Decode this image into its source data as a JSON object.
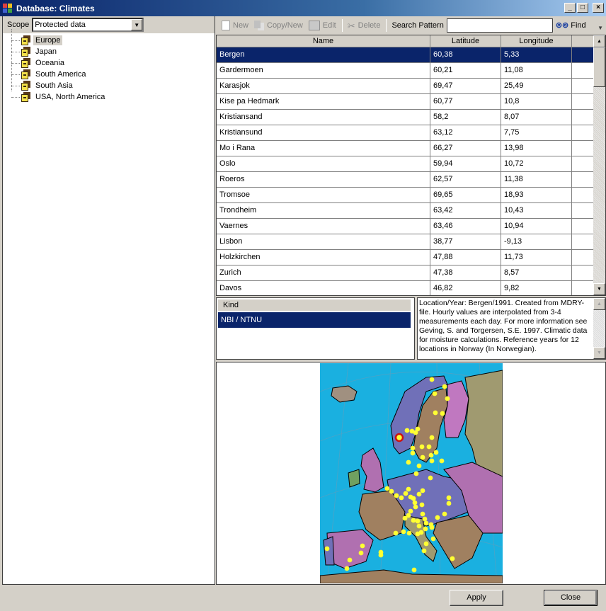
{
  "window": {
    "title": "Database: Climates",
    "controls": {
      "minimize": "_",
      "maximize": "□",
      "close": "×"
    }
  },
  "scope": {
    "label": "Scope",
    "selected": "Protected data"
  },
  "tree": {
    "items": [
      {
        "label": "Europe",
        "icon": "database-icon",
        "selected": true
      },
      {
        "label": "Japan",
        "icon": "database-icon",
        "selected": false
      },
      {
        "label": "Oceania",
        "icon": "database-icon",
        "selected": false
      },
      {
        "label": "South America",
        "icon": "database-icon",
        "selected": false
      },
      {
        "label": "South Asia",
        "icon": "database-icon",
        "selected": false
      },
      {
        "label": "USA, North America",
        "icon": "database-icon",
        "selected": false
      }
    ]
  },
  "toolbar": {
    "new_label": "New",
    "copy_new_label": "Copy/New",
    "edit_label": "Edit",
    "delete_label": "Delete",
    "search_label": "Search Pattern",
    "search_value": "",
    "find_label": "Find"
  },
  "grid": {
    "columns": [
      "Name",
      "Latitude",
      "Longitude"
    ],
    "rows": [
      {
        "name": "Bergen",
        "lat": "60,38",
        "lon": "5,33",
        "selected": true
      },
      {
        "name": "Gardermoen",
        "lat": "60,21",
        "lon": "11,08"
      },
      {
        "name": "Karasjok",
        "lat": "69,47",
        "lon": "25,49"
      },
      {
        "name": "Kise pa Hedmark",
        "lat": "60,77",
        "lon": "10,8"
      },
      {
        "name": "Kristiansand",
        "lat": "58,2",
        "lon": "8,07"
      },
      {
        "name": "Kristiansund",
        "lat": "63,12",
        "lon": "7,75"
      },
      {
        "name": "Mo i Rana",
        "lat": "66,27",
        "lon": "13,98"
      },
      {
        "name": "Oslo",
        "lat": "59,94",
        "lon": "10,72"
      },
      {
        "name": "Roeros",
        "lat": "62,57",
        "lon": "11,38"
      },
      {
        "name": "Tromsoe",
        "lat": "69,65",
        "lon": "18,93"
      },
      {
        "name": "Trondheim",
        "lat": "63,42",
        "lon": "10,43"
      },
      {
        "name": "Vaernes",
        "lat": "63,46",
        "lon": "10,94"
      },
      {
        "name": "Lisbon",
        "lat": "38,77",
        "lon": "-9,13"
      },
      {
        "name": "Holzkirchen",
        "lat": "47,88",
        "lon": "11,73"
      },
      {
        "name": "Zurich",
        "lat": "47,38",
        "lon": "8,57"
      },
      {
        "name": "Davos",
        "lat": "46,82",
        "lon": "9,82"
      }
    ]
  },
  "kind": {
    "header": "Kind",
    "selected": "NBI / NTNU"
  },
  "description": "Location/Year: Bergen/1991. Created from MDRY-file. Hourly values are interpolated from 3-4 measurements each day. For more information see Geving, S. and Torgersen, S.E. 1997. Climatic data for moisture calculations. Reference years for 12 locations in Norway (In Norwegian).",
  "map": {
    "region": "Europe",
    "selected_station": "Bergen",
    "colors": {
      "sea": "#1ab0e0",
      "station": "#ffff33",
      "selected_station": "#cc1111"
    }
  },
  "footer": {
    "apply_label": "Apply",
    "close_label": "Close"
  }
}
